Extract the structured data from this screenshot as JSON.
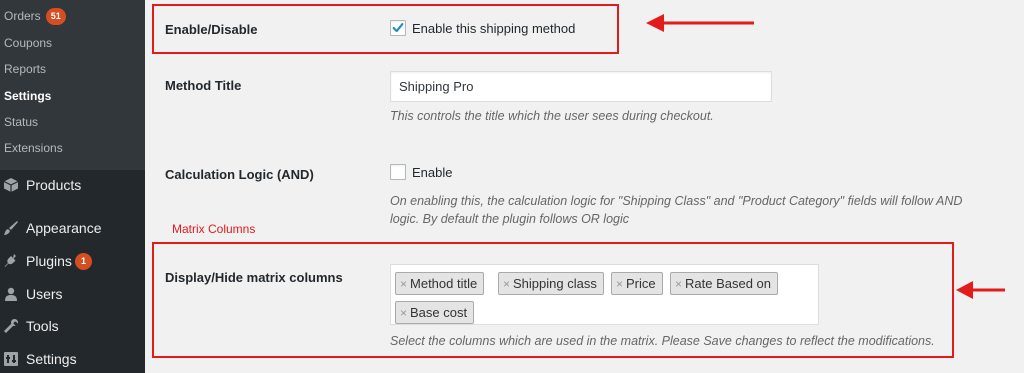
{
  "sidebar": {
    "submenu": [
      {
        "label": "Orders",
        "badge": "51"
      },
      {
        "label": "Coupons"
      },
      {
        "label": "Reports"
      },
      {
        "label": "Settings",
        "active": true
      },
      {
        "label": "Status"
      },
      {
        "label": "Extensions"
      }
    ],
    "menu": [
      {
        "label": "Products",
        "icon": "cube-icon"
      },
      {
        "label": "Appearance",
        "icon": "paintbrush-icon"
      },
      {
        "label": "Plugins",
        "icon": "plugin-icon",
        "badge": "1"
      },
      {
        "label": "Users",
        "icon": "users-icon"
      },
      {
        "label": "Tools",
        "icon": "wrench-icon"
      },
      {
        "label": "Settings",
        "icon": "settings-icon"
      }
    ]
  },
  "form": {
    "enable": {
      "label": "Enable/Disable",
      "checkbox_label": "Enable this shipping method",
      "checked": true
    },
    "method_title": {
      "label": "Method Title",
      "value": "Shipping Pro",
      "description": "This controls the title which the user sees during checkout."
    },
    "calc_logic": {
      "label": "Calculation Logic (AND)",
      "checkbox_label": "Enable",
      "checked": false,
      "description_line1": "On enabling this, the calculation logic for \"Shipping Class\" and \"Product Category\" fields will follow AND",
      "description_line2": "logic. By default the plugin follows OR logic"
    },
    "matrix": {
      "label": "Display/Hide matrix columns",
      "chips": [
        "Method title",
        "Shipping class",
        "Price",
        "Rate Based on",
        "Base cost"
      ],
      "remove_glyph": "×",
      "description": "Select the columns which are used in the matrix. Please Save changes to reflect the modifications."
    }
  },
  "annotations": {
    "matrix_columns_label": "Matrix Columns",
    "highlight_color": "#e21b1b"
  },
  "colors": {
    "sidebar_bg": "#23282d",
    "submenu_bg": "#32373c",
    "badge": "#d54e21",
    "check_blue": "#1e8cbe"
  }
}
